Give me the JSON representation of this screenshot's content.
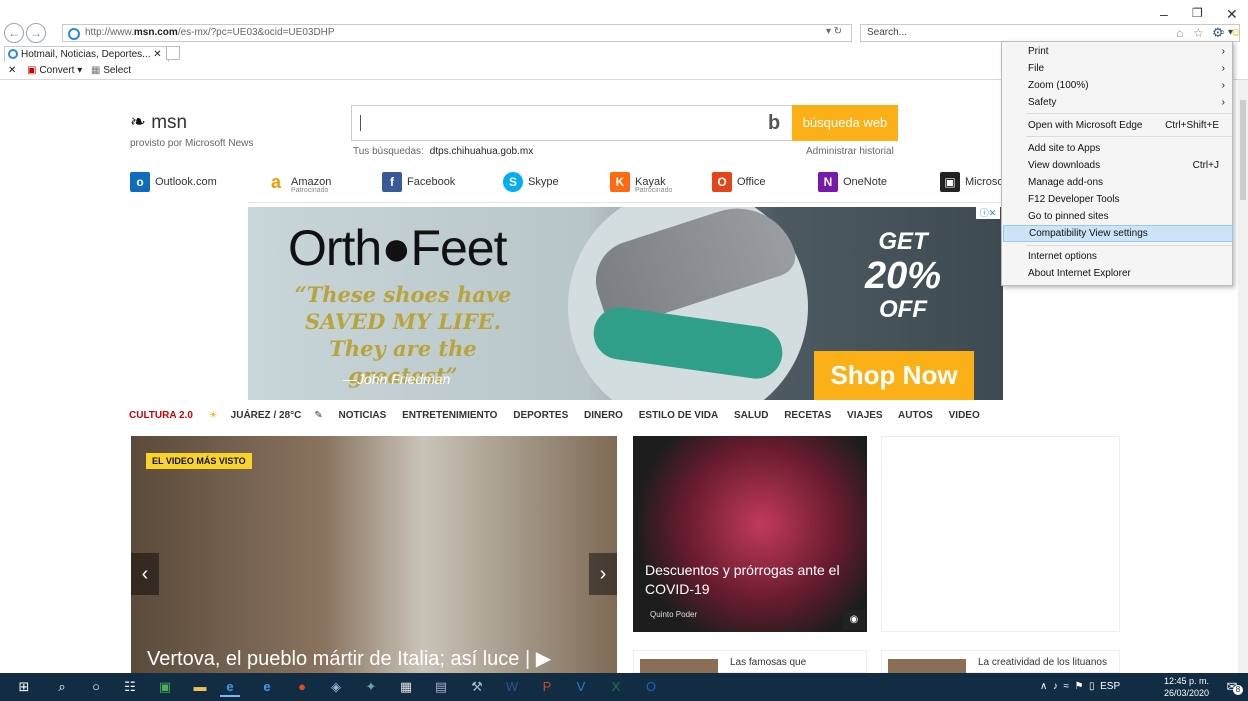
{
  "browser": {
    "url_prefix": "http://www.",
    "url_domain": "msn.com",
    "url_rest": "/es-mx/?pc=UE03&ocid=UE03DHP",
    "search_placeholder": "Search...",
    "tab_title": "Hotmail, Noticias, Deportes...",
    "toolbar_convert": "Convert",
    "toolbar_select": "Select"
  },
  "msn": {
    "logo": "msn",
    "tagline": "provisto por Microsoft News",
    "search_button": "búsqueda web",
    "recent_label": "Tus búsquedas:",
    "recent_value": "dtps.chihuahua.gob.mx",
    "manage_history": "Administrar historial"
  },
  "quick_links": [
    {
      "label": "Outlook.com",
      "icon": "outlook-icon",
      "color": "#0f6cbd"
    },
    {
      "label": "Amazon",
      "sub": "Patrocinado",
      "icon": "amazon-icon",
      "color": "#f49c00"
    },
    {
      "label": "Facebook",
      "icon": "facebook-icon",
      "color": "#3b5998"
    },
    {
      "label": "Skype",
      "icon": "skype-icon",
      "color": "#00aff0"
    },
    {
      "label": "Kayak",
      "sub": "Patrocinado",
      "icon": "kayak-icon",
      "color": "#ff690f"
    },
    {
      "label": "Office",
      "icon": "office-icon",
      "color": "#e3441a"
    },
    {
      "label": "OneNote",
      "icon": "onenote-icon",
      "color": "#7719aa"
    },
    {
      "label": "Microso",
      "icon": "store-icon",
      "color": "#222222"
    }
  ],
  "ad": {
    "brand": "Orth●Feet",
    "quote": "“These shoes have SAVED MY LIFE. They are the greatest”",
    "author": "—John Friedman",
    "get": "GET",
    "pct": "20%",
    "off": "OFF",
    "cta": "Shop Now"
  },
  "nav": {
    "cultura": "CULTURA 2.0",
    "weather": "JUÁREZ / 28°C",
    "items": [
      "NOTICIAS",
      "ENTRETENIMIENTO",
      "DEPORTES",
      "DINERO",
      "ESTILO DE VIDA",
      "SALUD",
      "RECETAS",
      "VIAJES",
      "AUTOS",
      "VIDEO"
    ]
  },
  "hero": {
    "badge": "EL VIDEO MÁS VISTO",
    "title": "Vertova, el pueblo mártir de Italia; así luce | ▶"
  },
  "card2": {
    "title": "Descuentos y prórrogas ante el COVID-19",
    "source": "Quinto Poder"
  },
  "small_cards": [
    {
      "title": "Las famosas que"
    },
    {
      "title": "La creatividad de los lituanos"
    }
  ],
  "menu": {
    "items": [
      {
        "label": "Print",
        "chevron": "›"
      },
      {
        "label": "File",
        "chevron": "›"
      },
      {
        "label": "Zoom (100%)",
        "chevron": "›"
      },
      {
        "label": "Safety",
        "chevron": "›"
      },
      {
        "label": "Open with Microsoft Edge",
        "shortcut": "Ctrl+Shift+E"
      },
      {
        "label": "Add site to Apps"
      },
      {
        "label": "View downloads",
        "shortcut": "Ctrl+J"
      },
      {
        "label": "Manage add-ons"
      },
      {
        "label": "F12 Developer Tools"
      },
      {
        "label": "Go to pinned sites"
      },
      {
        "label": "Compatibility View settings",
        "highlighted": true
      },
      {
        "label": "Internet options"
      },
      {
        "label": "About Internet Explorer"
      }
    ]
  },
  "taskbar": {
    "lang": "ESP",
    "time": "12:45 p. m.",
    "date": "26/03/2020",
    "notifications": "8"
  }
}
